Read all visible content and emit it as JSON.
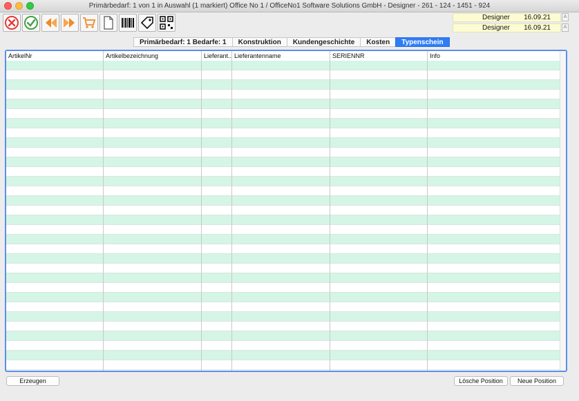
{
  "window": {
    "title": "Primärbedarf: 1 von 1 in Auswahl  (1 markiert) Office No 1 /  OfficeNo1 Software Solutions GmbH - Designer - 261 - 124 - 1451 - 924"
  },
  "toolbar": {
    "buttons": [
      {
        "icon": "cancel-icon",
        "color": "#e53935"
      },
      {
        "icon": "checkmark-icon",
        "color": "#43a047"
      },
      {
        "icon": "arrow-left-icon",
        "color": "#f08a24"
      },
      {
        "icon": "arrow-right-icon",
        "color": "#f08a24"
      },
      {
        "icon": "shopping-cart-icon",
        "color": "#f08a24"
      },
      {
        "icon": "document-icon",
        "color": "#555555"
      },
      {
        "icon": "barcode-icon",
        "color": "#111111"
      },
      {
        "icon": "tag-icon",
        "color": "#111111"
      },
      {
        "icon": "qr-code-icon",
        "color": "#111111"
      }
    ]
  },
  "user_info": [
    {
      "user": "Designer",
      "date": "16.09.21"
    },
    {
      "user": "Designer",
      "date": "16.09.21"
    }
  ],
  "tabs": [
    {
      "label": "Primärbedarf: 1 Bedarfe: 1",
      "active": false
    },
    {
      "label": "Konstruktion",
      "active": false
    },
    {
      "label": "Kundengeschichte",
      "active": false
    },
    {
      "label": "Kosten",
      "active": false
    },
    {
      "label": "Typenschein",
      "active": true
    }
  ],
  "table": {
    "columns": [
      "ArtikelNr",
      "Artikelbezeichnung",
      "Lieferant...",
      "Lieferantenname",
      "SERIENNR",
      "Info"
    ],
    "rows": []
  },
  "buttons": {
    "create": "Erzeugen",
    "delete_position": "Lösche Position",
    "new_position": "Neue Position"
  },
  "colors": {
    "accent": "#2f7cf6",
    "row_alt": "#d5f5e6",
    "user_bg": "#fdfbd2"
  }
}
